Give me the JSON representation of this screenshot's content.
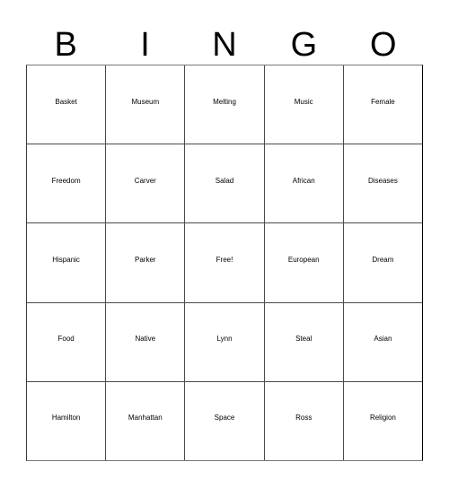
{
  "card": {
    "title": "BINGO card",
    "header_letters": [
      "B",
      "I",
      "N",
      "G",
      "O"
    ],
    "grid_color": "#000000",
    "background_color": "#ffffff",
    "text_color": "#000000",
    "rows": [
      [
        {
          "label": "Basket",
          "free": false
        },
        {
          "label": "Museum",
          "free": false
        },
        {
          "label": "Melting",
          "free": false
        },
        {
          "label": "Music",
          "free": false
        },
        {
          "label": "Female",
          "free": false
        }
      ],
      [
        {
          "label": "Freedom",
          "free": false
        },
        {
          "label": "Carver",
          "free": false
        },
        {
          "label": "Salad",
          "free": false
        },
        {
          "label": "African",
          "free": false
        },
        {
          "label": "Diseases",
          "free": false
        }
      ],
      [
        {
          "label": "Hispanic",
          "free": false
        },
        {
          "label": "Parker",
          "free": false
        },
        {
          "label": "Free!",
          "free": true
        },
        {
          "label": "European",
          "free": false
        },
        {
          "label": "Dream",
          "free": false
        }
      ],
      [
        {
          "label": "Food",
          "free": false
        },
        {
          "label": "Native",
          "free": false
        },
        {
          "label": "Lynn",
          "free": false
        },
        {
          "label": "Steal",
          "free": false
        },
        {
          "label": "Asian",
          "free": false
        }
      ],
      [
        {
          "label": "Hamilton",
          "free": false
        },
        {
          "label": "Manhattan",
          "free": false
        },
        {
          "label": "Space",
          "free": false
        },
        {
          "label": "Ross",
          "free": false
        },
        {
          "label": "Religion",
          "free": false
        }
      ]
    ]
  }
}
